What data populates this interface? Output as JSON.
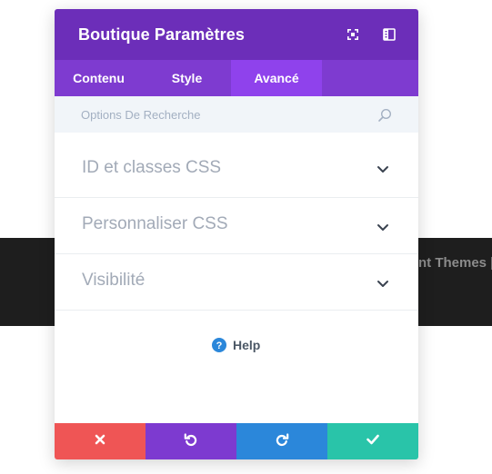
{
  "background": {
    "text": "nt Themes |"
  },
  "modal": {
    "title": "Boutique Paramètres",
    "tabs": [
      {
        "label": "Contenu",
        "active": false
      },
      {
        "label": "Style",
        "active": false
      },
      {
        "label": "Avancé",
        "active": true
      }
    ],
    "search": {
      "placeholder": "Options De Recherche",
      "value": ""
    },
    "sections": [
      {
        "label": "ID et classes CSS",
        "icon": "chevron-down-icon"
      },
      {
        "label": "Personnaliser CSS",
        "icon": "chevron-down-icon"
      },
      {
        "label": "Visibilité",
        "icon": "chevron-down-icon"
      }
    ],
    "help": {
      "label": "Help",
      "icon": "help-circle-icon"
    },
    "footer_buttons": [
      {
        "name": "cancel",
        "icon": "close-icon",
        "color": "#ef5555"
      },
      {
        "name": "undo",
        "icon": "undo-icon",
        "color": "#7d3ad0"
      },
      {
        "name": "redo",
        "icon": "redo-icon",
        "color": "#2b87da"
      },
      {
        "name": "save",
        "icon": "checkmark-icon",
        "color": "#29c4a9"
      }
    ]
  },
  "colors": {
    "header": "#6c2eb9",
    "tabs_bar": "#7e3bd0",
    "active_tab": "#8f42ec",
    "search_bg": "#f1f5f9",
    "help_icon": "#2b87da"
  }
}
